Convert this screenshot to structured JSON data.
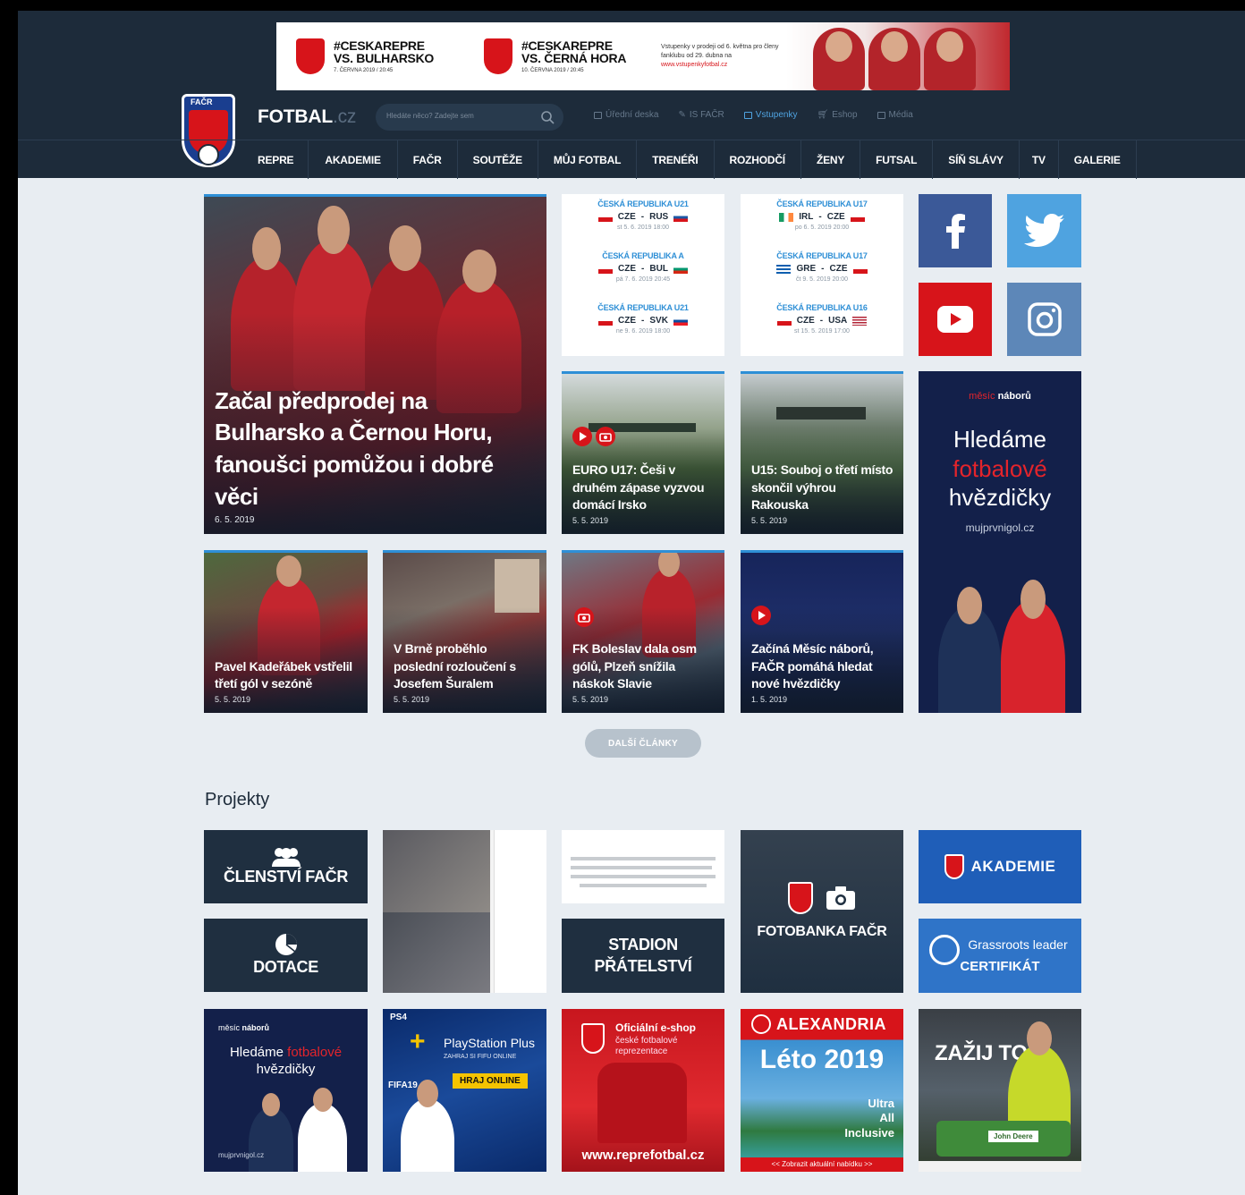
{
  "banner": {
    "match1": {
      "tag": "#CESKAREPRE",
      "vs": "VS. BULHARSKO",
      "date": "7. ČERVNA 2019 / 20:45"
    },
    "match2": {
      "tag": "#CESKAREPRE",
      "vs": "VS. ČERNÁ HORA",
      "date": "10. ČERVNA 2019 / 20:45"
    },
    "info": "Vstupenky v prodeji od 6. května pro členy fanklubu od 29. dubna na",
    "info_link": "www.vstupenkyfotbal.cz"
  },
  "header": {
    "logo_text": "FAČR",
    "site_name": "FOTBAL",
    "site_suffix": ".cz",
    "search_placeholder": "Hledáte něco? Zadejte sem",
    "utils": [
      {
        "label": "Úřední deska",
        "icon": "board-icon"
      },
      {
        "label": "IS FAČR",
        "icon": "pen-icon"
      },
      {
        "label": "Vstupenky",
        "icon": "ticket-icon",
        "active": true
      },
      {
        "label": "Eshop",
        "icon": "cart-icon"
      },
      {
        "label": "Média",
        "icon": "media-icon"
      }
    ],
    "nav": [
      "REPRE",
      "AKADEMIE",
      "FAČR",
      "SOUTĚŽE",
      "MŮJ FOTBAL",
      "TRENÉŘI",
      "ROZHODČÍ",
      "ŽENY",
      "FUTSAL",
      "SÍŇ SLÁVY",
      "TV",
      "GALERIE"
    ]
  },
  "articles": {
    "main": {
      "title": "Začal předprodej na Bulharsko a Černou Horu, fanoušci pomůžou i dobré věci",
      "date": "6. 5. 2019"
    },
    "a1": {
      "title": "EURO U17: Češi v druhém zápase vyzvou domácí Irsko",
      "date": "5. 5. 2019"
    },
    "a2": {
      "title": "U15: Souboj o třetí místo skončil výhrou Rakouska",
      "date": "5. 5. 2019"
    },
    "a3": {
      "title": "Pavel Kadeřábek vstřelil třetí gól v sezóně",
      "date": "5. 5. 2019"
    },
    "a4": {
      "title": "V Brně proběhlo poslední rozloučení s Josefem Šuralem",
      "date": "5. 5. 2019"
    },
    "a5": {
      "title": "FK Boleslav dala osm gólů, Plzeň snížila náskok Slavie",
      "date": "5. 5. 2019"
    },
    "a6": {
      "title": "Začíná Měsíc náborů, FAČR pomáhá hledat nové hvězdičky",
      "date": "1. 5. 2019"
    }
  },
  "results_left": [
    {
      "label": "ČESKÁ REPUBLIKA U21",
      "home": "CZE",
      "away": "RUS",
      "date": "st 5. 6. 2019 18:00"
    },
    {
      "label": "ČESKÁ REPUBLIKA A",
      "home": "CZE",
      "away": "BUL",
      "date": "pá 7. 6. 2019 20:45"
    },
    {
      "label": "ČESKÁ REPUBLIKA U21",
      "home": "CZE",
      "away": "SVK",
      "date": "ne 9. 6. 2019 18:00"
    }
  ],
  "results_right": [
    {
      "label": "ČESKÁ REPUBLIKA U17",
      "home": "IRL",
      "away": "CZE",
      "date": "po 6. 5. 2019 20:00"
    },
    {
      "label": "ČESKÁ REPUBLIKA U17",
      "home": "GRE",
      "away": "CZE",
      "date": "čt 9. 5. 2019 20:00"
    },
    {
      "label": "ČESKÁ REPUBLIKA U16",
      "home": "CZE",
      "away": "USA",
      "date": "st 15. 5. 2019 17:00"
    }
  ],
  "side_ad": {
    "brand_pre": "měsíc",
    "brand": "náborů",
    "line1": "Hledáme",
    "line2": "fotbalové",
    "line3": "hvězdičky",
    "url": "mujprvnigol.cz"
  },
  "more_button": "DALŠÍ ČLÁNKY",
  "projects": {
    "title": "Projekty",
    "membership": "ČLENSTVÍ FAČR",
    "grants": "DOTACE",
    "stadium": "STADION PŘÁTELSTVÍ",
    "photobank": "FOTOBANKA FAČR",
    "academy": "AKADEMIE",
    "grassroots": "Grassroots leader",
    "certificate": "CERTIFIKÁT",
    "ad_recruit": {
      "brand_pre": "měsíc",
      "brand": "náborů",
      "line1": "Hledáme",
      "line2": "fotbalové",
      "line3": "hvězdičky",
      "url": "mujprvnigol.cz"
    },
    "ad_ps": {
      "brand": "PS4",
      "line1": "PlayStation Plus",
      "line2": "ZAHRAJ SI FIFU ONLINE",
      "button": "HRAJ ONLINE",
      "game": "FIFA19"
    },
    "ad_shop": {
      "line1": "Oficiální e-shop",
      "line2": "české fotbalové reprezentace",
      "url": "www.reprefotbal.cz"
    },
    "ad_alex": {
      "brand": "ALEXANDRIA",
      "title": "Léto 2019",
      "line1": "Ultra",
      "line2": "All",
      "line3": "Inclusive",
      "link": "<< Zobrazit aktuální nabídku >>"
    },
    "ad_deere": {
      "title": "ZAŽIJ TO",
      "brand": "John Deere"
    }
  },
  "colors": {
    "header_bg": "#1d2b3a",
    "accent_blue": "#2e8fd6",
    "red": "#d7141a",
    "page_bg": "#e8edf2"
  }
}
